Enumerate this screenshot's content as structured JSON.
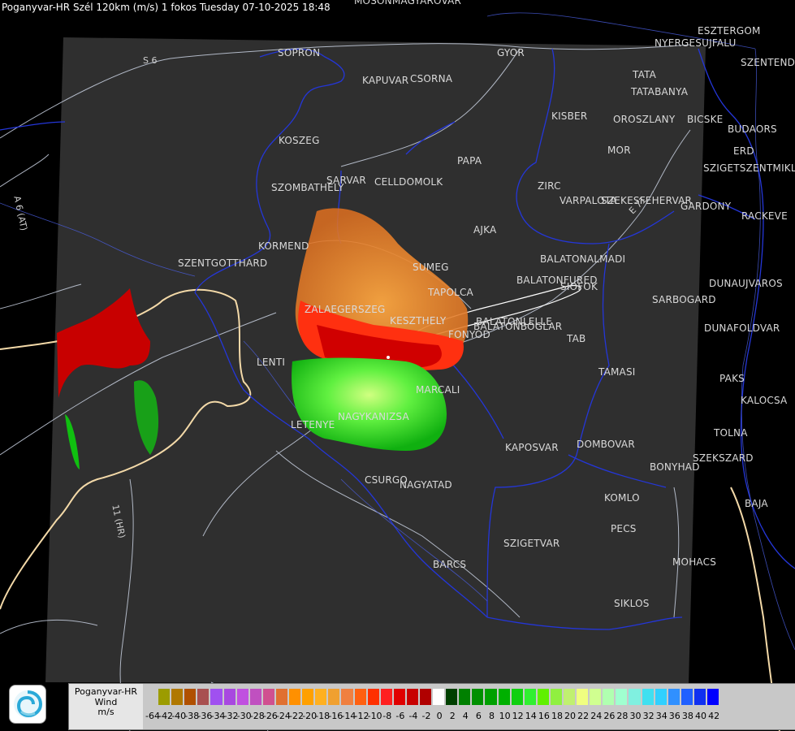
{
  "header": {
    "title": "Poganyvar-HR Szél 120km (m/s) 1 fokos Tuesday 07-10-2025 18:48"
  },
  "map": {
    "cities": [
      {
        "id": "mosonmagyarovar",
        "label": "MOSONMAGYAROVAR"
      },
      {
        "id": "sopron",
        "label": "SOPRON"
      },
      {
        "id": "gyor",
        "label": "GYOR"
      },
      {
        "id": "kapuvar",
        "label": "KAPUVAR"
      },
      {
        "id": "csorna",
        "label": "CSORNA"
      },
      {
        "id": "tata",
        "label": "TATA"
      },
      {
        "id": "tatabanya",
        "label": "TATABANYA"
      },
      {
        "id": "kisber",
        "label": "KISBER"
      },
      {
        "id": "oroszlany",
        "label": "OROSZLANY"
      },
      {
        "id": "biske",
        "label": "BICSKE"
      },
      {
        "id": "mor",
        "label": "MOR"
      },
      {
        "id": "koszeg",
        "label": "KOSZEG"
      },
      {
        "id": "papa",
        "label": "PAPA"
      },
      {
        "id": "sarvar",
        "label": "SARVAR"
      },
      {
        "id": "celldomolk",
        "label": "CELLDOMOLK"
      },
      {
        "id": "szombathely",
        "label": "SZOMBATHELY"
      },
      {
        "id": "zirc",
        "label": "ZIRC"
      },
      {
        "id": "varpalota",
        "label": "VARPALOTA"
      },
      {
        "id": "szekesfehervar",
        "label": "SZEKESFEHERVAR"
      },
      {
        "id": "gardony",
        "label": "GARDONY"
      },
      {
        "id": "ajka",
        "label": "AJKA"
      },
      {
        "id": "kormend",
        "label": "KORMEND"
      },
      {
        "id": "szentgotthard",
        "label": "SZENTGOTTHARD"
      },
      {
        "id": "sumeg",
        "label": "SUMEG"
      },
      {
        "id": "balatonalmadi",
        "label": "BALATONALMADI"
      },
      {
        "id": "balatonfured",
        "label": "BALATONFURED"
      },
      {
        "id": "siofok",
        "label": "SIOFOK"
      },
      {
        "id": "tapolca",
        "label": "TAPOLCA"
      },
      {
        "id": "zalaegerszeg",
        "label": "ZALAEGERSZEG"
      },
      {
        "id": "balatonlelle",
        "label": "BALATONLELLE"
      },
      {
        "id": "balatonboglar",
        "label": "BALATONBOGLAR"
      },
      {
        "id": "fonyod",
        "label": "FONYOD"
      },
      {
        "id": "keszthely",
        "label": "KESZTHELY"
      },
      {
        "id": "lenti",
        "label": "LENTI"
      },
      {
        "id": "tab",
        "label": "TAB"
      },
      {
        "id": "marcali",
        "label": "MARCALI"
      },
      {
        "id": "tamasi",
        "label": "TAMASI"
      },
      {
        "id": "nagykanizsa",
        "label": "NAGYKANIZSA"
      },
      {
        "id": "letenye",
        "label": "LETENYE"
      },
      {
        "id": "kaposvar",
        "label": "KAPOSVAR"
      },
      {
        "id": "dombovar",
        "label": "DOMBOVAR"
      },
      {
        "id": "csurgo",
        "label": "CSURGO"
      },
      {
        "id": "nagyatad",
        "label": "NAGYATAD"
      },
      {
        "id": "bonyhad",
        "label": "BONYHAD"
      },
      {
        "id": "szekszard",
        "label": "SZEKSZARD"
      },
      {
        "id": "komlo",
        "label": "KOMLO"
      },
      {
        "id": "pecs",
        "label": "PECS"
      },
      {
        "id": "szigetvar",
        "label": "SZIGETVAR"
      },
      {
        "id": "mohacs",
        "label": "MOHACS"
      },
      {
        "id": "barcs",
        "label": "BARCS"
      },
      {
        "id": "siklos",
        "label": "SIKLOS"
      },
      {
        "id": "esztergom",
        "label": "ESZTERGOM"
      },
      {
        "id": "nyergesujfalu",
        "label": "NYERGESUJFALU"
      },
      {
        "id": "szentendre",
        "label": "SZENTENDRE"
      },
      {
        "id": "budaors",
        "label": "BUDAORS"
      },
      {
        "id": "erd",
        "label": "ERD"
      },
      {
        "id": "szigetszentmiklos",
        "label": "SZIGETSZENTMIKLOS"
      },
      {
        "id": "rackeve",
        "label": "RACKEVE"
      },
      {
        "id": "dunaujvaros",
        "label": "DUNAUJVAROS"
      },
      {
        "id": "sarbogard",
        "label": "SARBOGARD"
      },
      {
        "id": "dunafoldvar",
        "label": "DUNAFOLDVAR"
      },
      {
        "id": "paks",
        "label": "PAKS"
      },
      {
        "id": "kalocsa",
        "label": "KALOCSA"
      },
      {
        "id": "tolna",
        "label": "TOLNA"
      },
      {
        "id": "baja",
        "label": "BAJA"
      }
    ],
    "roads": [
      {
        "id": "s6",
        "label": "S 6"
      },
      {
        "id": "a6",
        "label": "A 6 (AT)"
      },
      {
        "id": "e71",
        "label": "E 71"
      },
      {
        "id": "r11",
        "label": "11 (HR)"
      }
    ]
  },
  "legend": {
    "label_line1": "Poganyvar-HR",
    "label_line2": "Wind",
    "label_line3": "m/s",
    "colors": [
      "#c8c8c8",
      "#9c9c00",
      "#b07800",
      "#b05000",
      "#a85050",
      "#a050f0",
      "#a848e0",
      "#c050e0",
      "#c050c0",
      "#d05090",
      "#e07030",
      "#ff9000",
      "#ffa000",
      "#ffb020",
      "#f0a030",
      "#f08040",
      "#ff6010",
      "#ff3000",
      "#ff2020",
      "#e00000",
      "#c80000",
      "#b00000",
      "#ffffff",
      "#004000",
      "#008000",
      "#009000",
      "#00a000",
      "#00b000",
      "#10d010",
      "#30f030",
      "#60f000",
      "#90f040",
      "#c0f070",
      "#f0ff80",
      "#d0ff90",
      "#b0ffb0",
      "#a0ffd0",
      "#80f0e0",
      "#40e0f0",
      "#30d0ff",
      "#3090ff",
      "#2060ff",
      "#1030f0",
      "#0000ff"
    ],
    "ticks": [
      "-64",
      "-42",
      "-40",
      "-38",
      "-36",
      "-34",
      "-32",
      "-30",
      "-28",
      "-26",
      "-24",
      "-22",
      "-20",
      "-18",
      "-16",
      "-14",
      "-12",
      "-10",
      "-8",
      "-6",
      "-4",
      "-2",
      "0",
      "2",
      "4",
      "6",
      "8",
      "10",
      "12",
      "14",
      "16",
      "18",
      "20",
      "22",
      "24",
      "26",
      "28",
      "30",
      "32",
      "34",
      "36",
      "38",
      "40",
      "42"
    ]
  },
  "colors": {
    "background": "#000000",
    "radar_area": "#2f2f2f",
    "border": "#1f2fd0",
    "roads": "#c8d0e0",
    "state_border": "#f3d9a8"
  }
}
